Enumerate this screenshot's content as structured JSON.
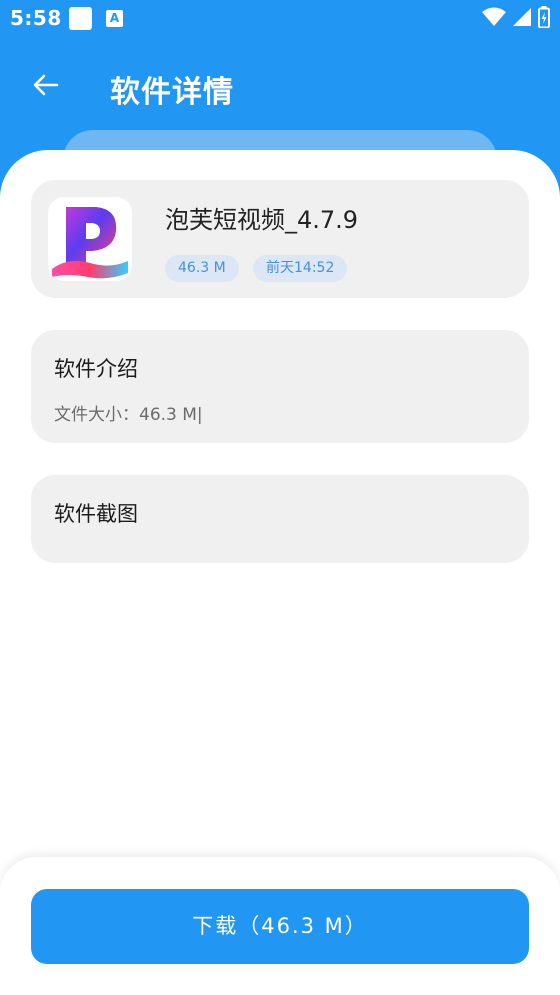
{
  "status_bar": {
    "time": "5:58",
    "icons": [
      "notification-square-icon",
      "translate-icon",
      "wifi-icon",
      "signal-icon",
      "battery-icon"
    ]
  },
  "header": {
    "back_icon": "arrow-left-icon",
    "title": "软件详情"
  },
  "app": {
    "name": "泡芙短视频_4.7.9",
    "size_tag": "46.3 M",
    "time_tag": "前天14:52"
  },
  "intro": {
    "heading": "软件介绍",
    "text": "文件大小：46.3 M|"
  },
  "screenshots": {
    "heading": "软件截图"
  },
  "download": {
    "label": "下载（46.3 M）"
  },
  "colors": {
    "primary": "#2196f3",
    "card_bg": "#f0f0f0",
    "tag_bg": "#dbe7f4",
    "tag_text": "#4a8fd9"
  }
}
